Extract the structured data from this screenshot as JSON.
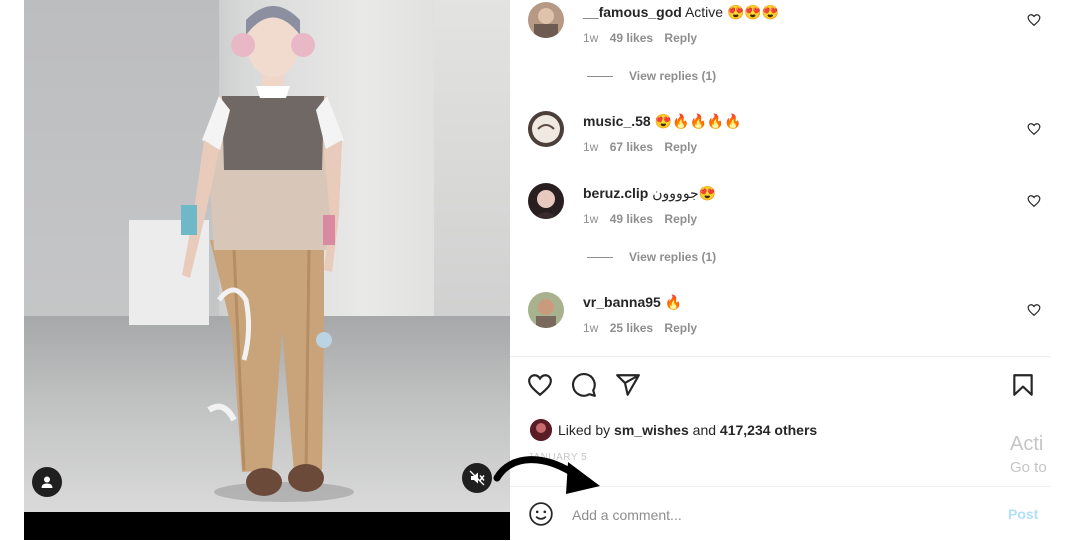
{
  "post": {
    "comments": [
      {
        "user": "__famous_god",
        "text": "Active",
        "emoji": "😍😍😍",
        "age": "1w",
        "likes": "49 likes",
        "reply": "Reply",
        "view_replies": "View replies (1)"
      },
      {
        "user": "music_.58",
        "text": "",
        "emoji": "😍🔥🔥🔥🔥",
        "age": "1w",
        "likes": "67 likes",
        "reply": "Reply"
      },
      {
        "user": "beruz.clip",
        "text": "جوووون",
        "emoji": "😍",
        "age": "1w",
        "likes": "49 likes",
        "reply": "Reply",
        "view_replies": "View replies (1)"
      },
      {
        "user": "vr_banna95",
        "text": "",
        "emoji": "🔥",
        "age": "1w",
        "likes": "25 likes",
        "reply": "Reply"
      }
    ],
    "liked_by": {
      "prefix": "Liked by",
      "user": "sm_wishes",
      "middle": "and",
      "others": "417,234 others"
    },
    "date": "JANUARY 5",
    "add_comment": {
      "placeholder": "Add a comment...",
      "post_label": "Post"
    },
    "icons": [
      "heart-icon",
      "comment-icon",
      "share-icon",
      "bookmark-icon",
      "emoji-icon",
      "user-icon",
      "mute-icon"
    ]
  },
  "watermark": {
    "line1": "Acti",
    "line2": "Go to"
  },
  "colors": {
    "link": "#b2dffc",
    "muted": "#8e8e8e",
    "text": "#262626"
  }
}
